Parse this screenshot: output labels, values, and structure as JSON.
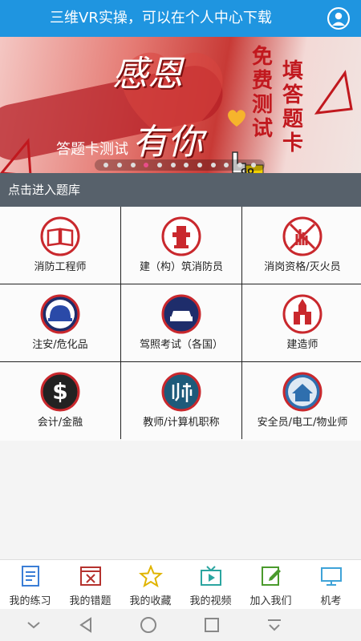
{
  "header": {
    "title": "三维VR实操，可以在个人中心下载",
    "user_icon": "user-icon"
  },
  "banner": {
    "line1": "感恩",
    "line2": "有你",
    "subtitle": "答题卡测试",
    "col1": "免费测试",
    "col2": "填答题卡",
    "go_label": "GO",
    "slides": 12,
    "active_slide": 3
  },
  "section": {
    "title": "点击进入题库"
  },
  "categories": [
    {
      "label": "消防工程师",
      "icon": "book-icon"
    },
    {
      "label": "建（构）筑消防员",
      "icon": "fire-hydrant-icon"
    },
    {
      "label": "消岗资格/灭火员",
      "icon": "no-fire-icon"
    },
    {
      "label": "注安/危化品",
      "icon": "safety-helmet-icon"
    },
    {
      "label": "驾照考试（各国）",
      "icon": "car-icon"
    },
    {
      "label": "建造师",
      "icon": "building-icon"
    },
    {
      "label": "会计/金融",
      "icon": "dollar-icon"
    },
    {
      "label": "教师/计算机职称",
      "icon": "teacher-icon"
    },
    {
      "label": "安全员/电工/物业师",
      "icon": "house-icon"
    }
  ],
  "tabs": [
    {
      "label": "我的练习",
      "icon": "notebook-icon",
      "color": "#3b7ed6"
    },
    {
      "label": "我的错题",
      "icon": "wrong-card-icon",
      "color": "#b5322e"
    },
    {
      "label": "我的收藏",
      "icon": "star-icon",
      "color": "#e0b400"
    },
    {
      "label": "我的视频",
      "icon": "tv-icon",
      "color": "#2ba5a0"
    },
    {
      "label": "加入我们",
      "icon": "edit-icon",
      "color": "#4a9a2c"
    },
    {
      "label": "机考",
      "icon": "monitor-icon",
      "color": "#3fa3d8"
    }
  ],
  "colors": {
    "header_bg": "#1f95e0",
    "section_bg": "#57616b",
    "icon_red": "#c9282d",
    "icon_navy": "#1e2d6b"
  }
}
